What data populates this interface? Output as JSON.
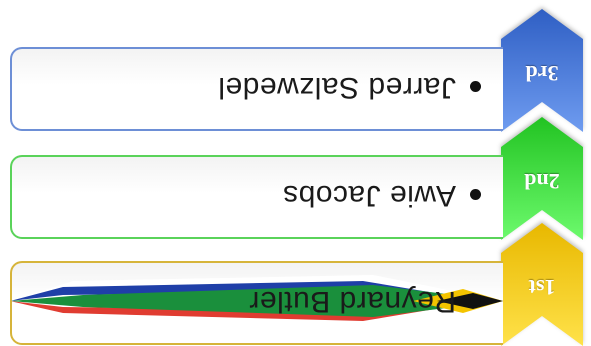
{
  "ranking": [
    {
      "place": "1st",
      "name": "Reynard Butler",
      "color": "#f5c800",
      "border_color": "#d6b43a",
      "decoration": "south-africa-flag"
    },
    {
      "place": "2nd",
      "name": "Awie Jacobs",
      "color": "#2fd12f",
      "border_color": "#5ad35a"
    },
    {
      "place": "3rd",
      "name": "Jarred Salzwedel",
      "color": "#3f6fd1",
      "border_color": "#6d8fd6"
    }
  ],
  "icons": {
    "bullet": "bullet-dot-icon",
    "chevron": "chevron-arrow-icon"
  }
}
